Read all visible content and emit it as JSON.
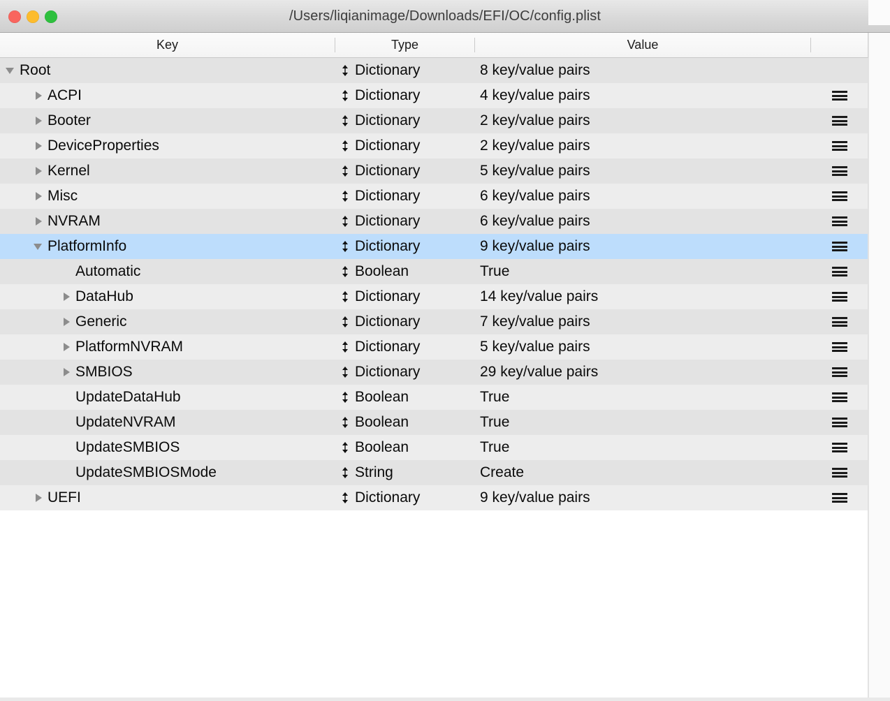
{
  "window": {
    "title": "/Users/liqianimage/Downloads/EFI/OC/config.plist",
    "traffic_lights": [
      {
        "name": "close",
        "color": "#f9655e"
      },
      {
        "name": "minimize",
        "color": "#fdbc2d"
      },
      {
        "name": "zoom",
        "color": "#2ec03e"
      }
    ]
  },
  "colors": {
    "row_odd": "#e3e3e3",
    "row_even": "#ededed",
    "selection": "#bdddfc",
    "text": "#0a0a0a",
    "triangle": "#8c8c8c"
  },
  "table": {
    "columns": [
      {
        "id": "key",
        "label": "Key"
      },
      {
        "id": "type",
        "label": "Type"
      },
      {
        "id": "value",
        "label": "Value"
      },
      {
        "id": "menu",
        "label": ""
      }
    ],
    "rows": [
      {
        "key": "Root",
        "level": 0,
        "disclosure": "expanded",
        "type": "Dictionary",
        "value": "8 key/value pairs",
        "menu": false,
        "selected": false
      },
      {
        "key": "ACPI",
        "level": 1,
        "disclosure": "collapsed",
        "type": "Dictionary",
        "value": "4 key/value pairs",
        "menu": true,
        "selected": false
      },
      {
        "key": "Booter",
        "level": 1,
        "disclosure": "collapsed",
        "type": "Dictionary",
        "value": "2 key/value pairs",
        "menu": true,
        "selected": false
      },
      {
        "key": "DeviceProperties",
        "level": 1,
        "disclosure": "collapsed",
        "type": "Dictionary",
        "value": "2 key/value pairs",
        "menu": true,
        "selected": false
      },
      {
        "key": "Kernel",
        "level": 1,
        "disclosure": "collapsed",
        "type": "Dictionary",
        "value": "5 key/value pairs",
        "menu": true,
        "selected": false
      },
      {
        "key": "Misc",
        "level": 1,
        "disclosure": "collapsed",
        "type": "Dictionary",
        "value": "6 key/value pairs",
        "menu": true,
        "selected": false
      },
      {
        "key": "NVRAM",
        "level": 1,
        "disclosure": "collapsed",
        "type": "Dictionary",
        "value": "6 key/value pairs",
        "menu": true,
        "selected": false
      },
      {
        "key": "PlatformInfo",
        "level": 1,
        "disclosure": "expanded",
        "type": "Dictionary",
        "value": "9 key/value pairs",
        "menu": true,
        "selected": true
      },
      {
        "key": "Automatic",
        "level": 2,
        "disclosure": "none",
        "type": "Boolean",
        "value": "True",
        "menu": true,
        "selected": false
      },
      {
        "key": "DataHub",
        "level": 2,
        "disclosure": "collapsed",
        "type": "Dictionary",
        "value": "14 key/value pairs",
        "menu": true,
        "selected": false
      },
      {
        "key": "Generic",
        "level": 2,
        "disclosure": "collapsed",
        "type": "Dictionary",
        "value": "7 key/value pairs",
        "menu": true,
        "selected": false
      },
      {
        "key": "PlatformNVRAM",
        "level": 2,
        "disclosure": "collapsed",
        "type": "Dictionary",
        "value": "5 key/value pairs",
        "menu": true,
        "selected": false
      },
      {
        "key": "SMBIOS",
        "level": 2,
        "disclosure": "collapsed",
        "type": "Dictionary",
        "value": "29 key/value pairs",
        "menu": true,
        "selected": false
      },
      {
        "key": "UpdateDataHub",
        "level": 2,
        "disclosure": "none",
        "type": "Boolean",
        "value": "True",
        "menu": true,
        "selected": false
      },
      {
        "key": "UpdateNVRAM",
        "level": 2,
        "disclosure": "none",
        "type": "Boolean",
        "value": "True",
        "menu": true,
        "selected": false
      },
      {
        "key": "UpdateSMBIOS",
        "level": 2,
        "disclosure": "none",
        "type": "Boolean",
        "value": "True",
        "menu": true,
        "selected": false
      },
      {
        "key": "UpdateSMBIOSMode",
        "level": 2,
        "disclosure": "none",
        "type": "String",
        "value": "Create",
        "menu": true,
        "selected": false
      },
      {
        "key": "UEFI",
        "level": 1,
        "disclosure": "collapsed",
        "type": "Dictionary",
        "value": "9 key/value pairs",
        "menu": true,
        "selected": false
      }
    ]
  },
  "icons": {
    "type_popup": "updown-arrow-icon",
    "row_menu": "hamburger-menu-icon"
  }
}
